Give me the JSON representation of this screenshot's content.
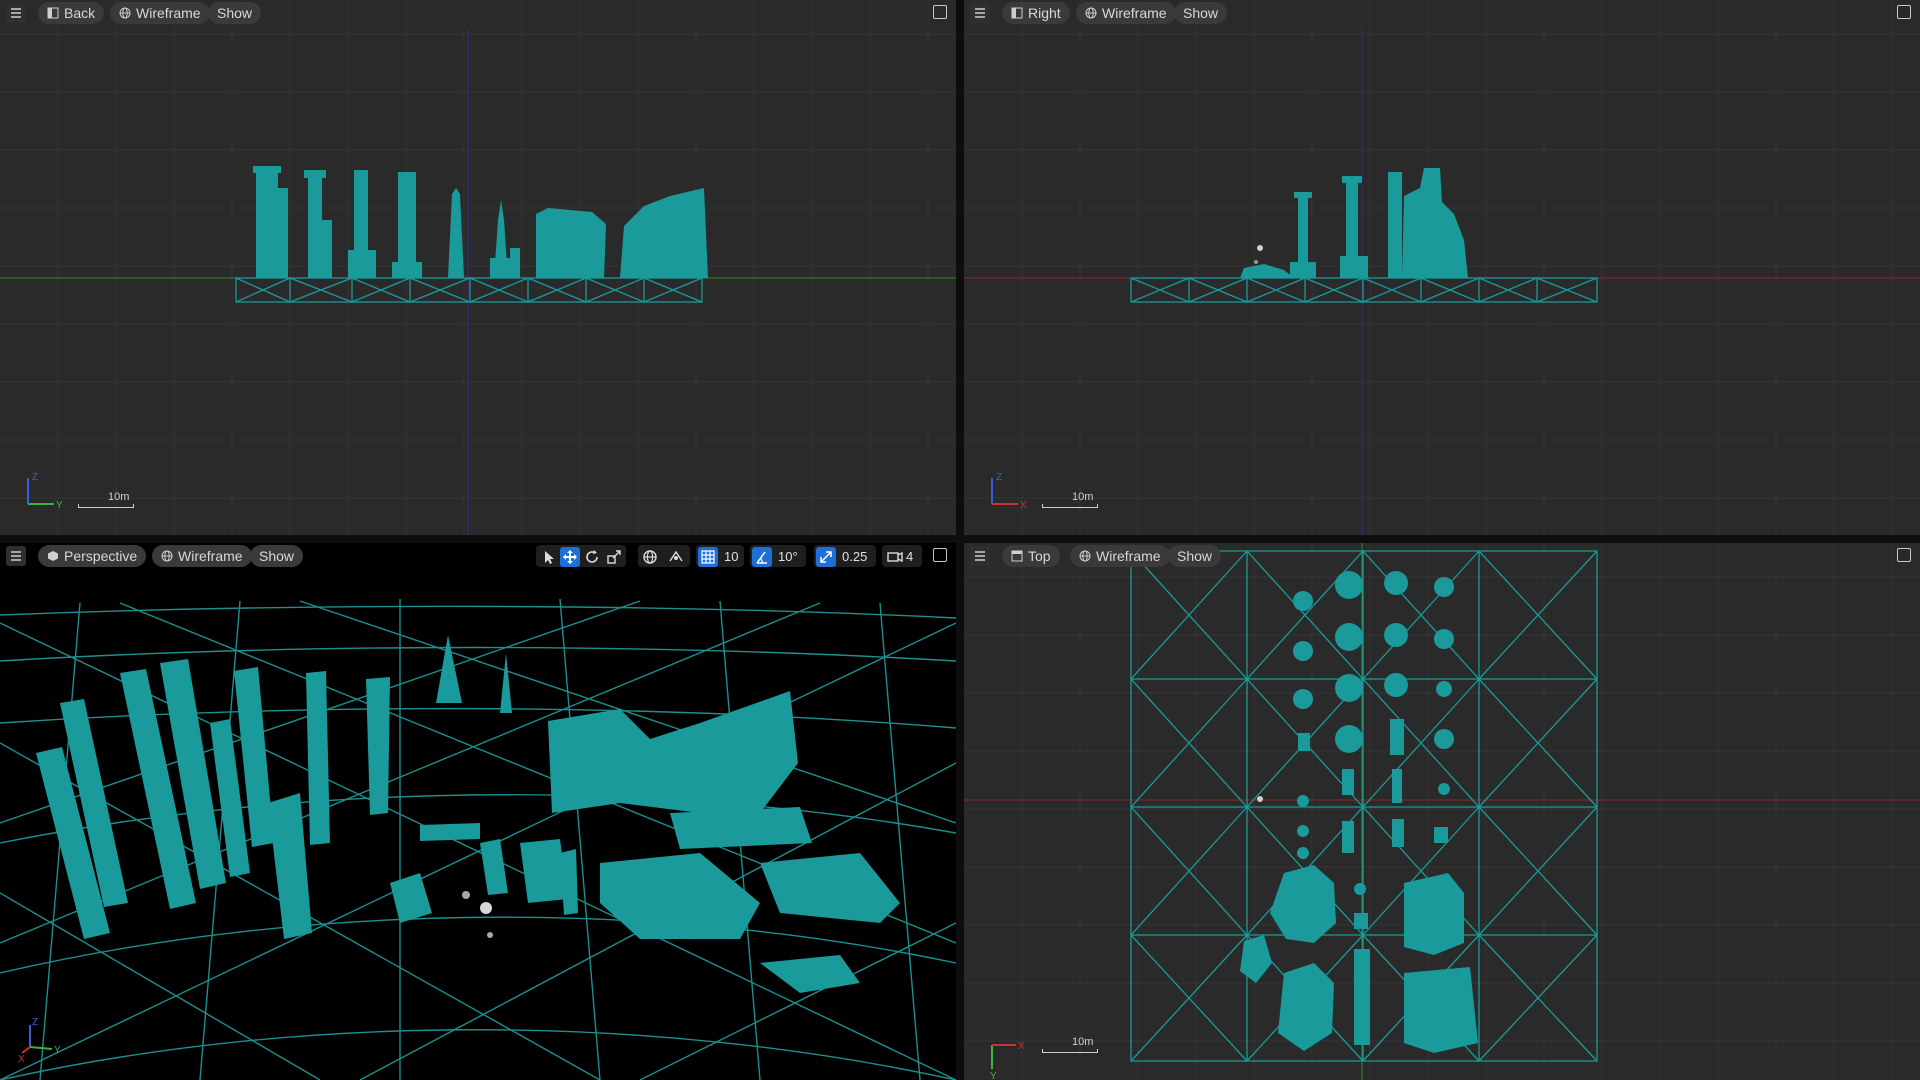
{
  "viewports": {
    "back": {
      "view_label": "Back",
      "mode_label": "Wireframe",
      "show_label": "Show",
      "scale_label": "10m",
      "axis_labels": [
        "Z",
        "Y"
      ]
    },
    "right": {
      "view_label": "Right",
      "mode_label": "Wireframe",
      "show_label": "Show",
      "scale_label": "10m",
      "axis_labels": [
        "Z",
        "X"
      ]
    },
    "perspective": {
      "view_label": "Perspective",
      "mode_label": "Wireframe",
      "show_label": "Show",
      "axis_labels": [
        "Z",
        "Y",
        "X"
      ],
      "transform_toolbar": {
        "grid_snap": "10",
        "rotation_snap": "10°",
        "scale_snap": "0.25",
        "camera_speed": "4"
      }
    },
    "top": {
      "view_label": "Top",
      "mode_label": "Wireframe",
      "show_label": "Show",
      "scale_label": "10m",
      "axis_labels": [
        "Y",
        "X"
      ]
    }
  },
  "colors": {
    "mesh": "#1a9a9a",
    "grid_bg": "#2a2a2a",
    "grid_line": "#343434",
    "persp_grid": "#1c8f8f",
    "active_tool": "#1e6fd6",
    "axis_x": "#c83232",
    "axis_y": "#3cb43c",
    "axis_z": "#3c5adc"
  },
  "icons": [
    "menu-icon",
    "view-icon",
    "wireframe-icon",
    "maximize-icon",
    "select-icon",
    "move-icon",
    "rotate-icon",
    "scale-icon",
    "world-icon",
    "surface-snap-icon",
    "grid-snap-icon",
    "rotation-snap-icon",
    "scale-snap-icon",
    "camera-speed-icon"
  ]
}
